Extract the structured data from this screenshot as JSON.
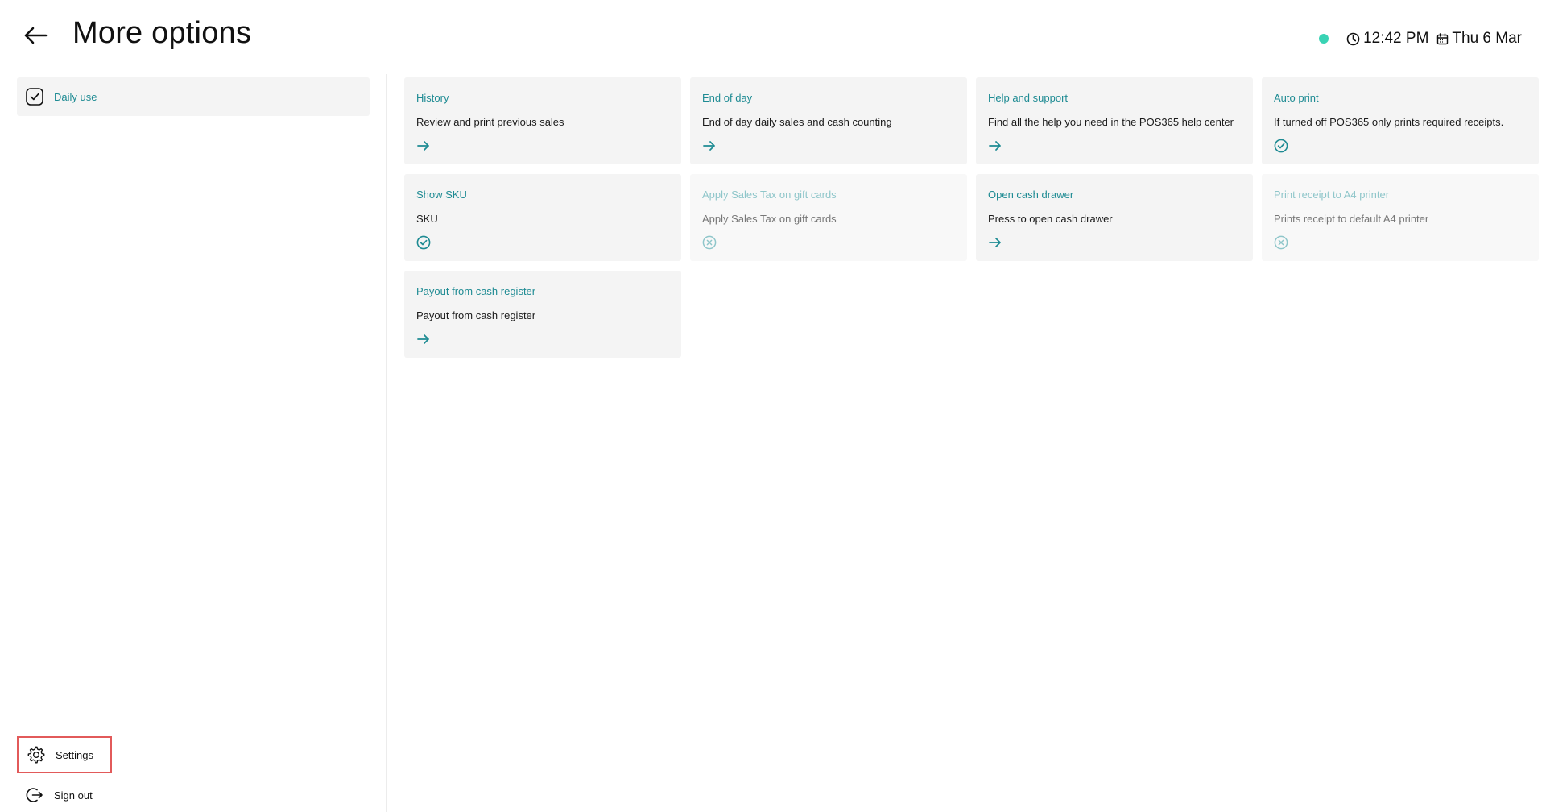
{
  "header": {
    "title": "More options",
    "time": "12:42 PM",
    "date": "Thu 6 Mar",
    "status_color": "#39d3b4"
  },
  "sidebar": {
    "active_item": {
      "label": "Daily use",
      "icon": "checkbox-checked-icon"
    },
    "settings_label": "Settings",
    "signout_label": "Sign out"
  },
  "colors": {
    "accent": "#1e8b93",
    "accent_disabled": "#8fc6ca",
    "card_bg": "#f4f4f4",
    "highlight_border": "#e25a5a"
  },
  "cards": [
    {
      "title": "History",
      "description": "Review and print previous sales",
      "icon": "arrow-right-icon",
      "enabled": true
    },
    {
      "title": "End of day",
      "description": "End of day daily sales and cash counting",
      "icon": "arrow-right-icon",
      "enabled": true
    },
    {
      "title": "Help and support",
      "description": "Find all the help you need in the POS365 help center",
      "icon": "arrow-right-icon",
      "enabled": true
    },
    {
      "title": "Auto print",
      "description": "If turned off POS365 only prints required receipts.",
      "icon": "check-circle-icon",
      "enabled": true
    },
    {
      "title": "Show SKU",
      "description": "SKU",
      "icon": "check-circle-icon",
      "enabled": true
    },
    {
      "title": "Apply Sales Tax on gift cards",
      "description": "Apply Sales Tax on gift cards",
      "icon": "x-circle-icon",
      "enabled": false
    },
    {
      "title": "Open cash drawer",
      "description": "Press to open cash drawer",
      "icon": "arrow-right-icon",
      "enabled": true
    },
    {
      "title": "Print receipt to A4 printer",
      "description": "Prints receipt to default A4 printer",
      "icon": "x-circle-icon",
      "enabled": false
    },
    {
      "title": "Payout from cash register",
      "description": "Payout from cash register",
      "icon": "arrow-right-icon",
      "enabled": true
    }
  ]
}
